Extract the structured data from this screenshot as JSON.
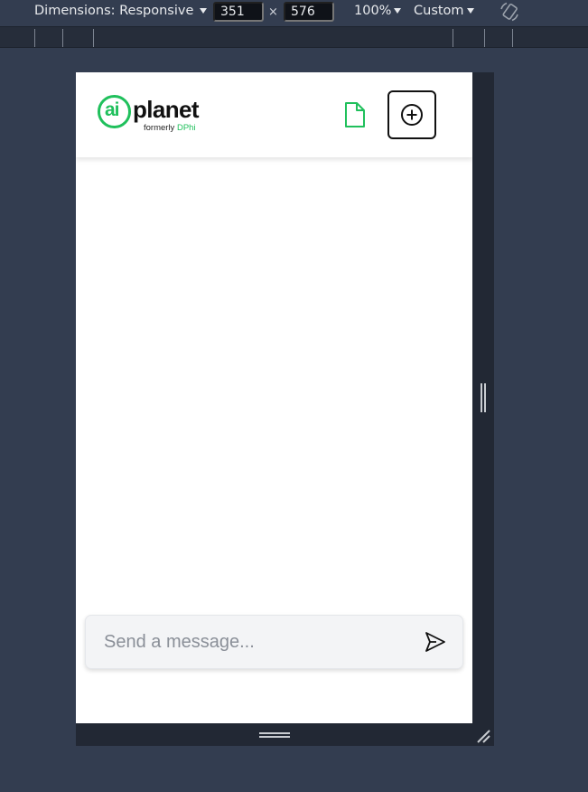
{
  "devtools": {
    "dimensions_label": "Dimensions: Responsive",
    "width_value": "351",
    "times_sign": "×",
    "height_value": "576",
    "zoom_label": "100%",
    "throttle_label": "Custom",
    "rotate_icon": "rotate-icon"
  },
  "app": {
    "logo": {
      "mark_text": "ai",
      "name": "planet",
      "sub_prefix": "formerly ",
      "sub_accent": "DPhi"
    },
    "header": {
      "document_icon": "file-icon",
      "new_chat_icon": "plus-circle-icon"
    },
    "composer": {
      "placeholder": "Send a message...",
      "value": "",
      "send_icon": "send-icon"
    }
  },
  "colors": {
    "brand_green": "#20c05c",
    "devtools_bg": "#333d50",
    "gutter": "#222834"
  }
}
